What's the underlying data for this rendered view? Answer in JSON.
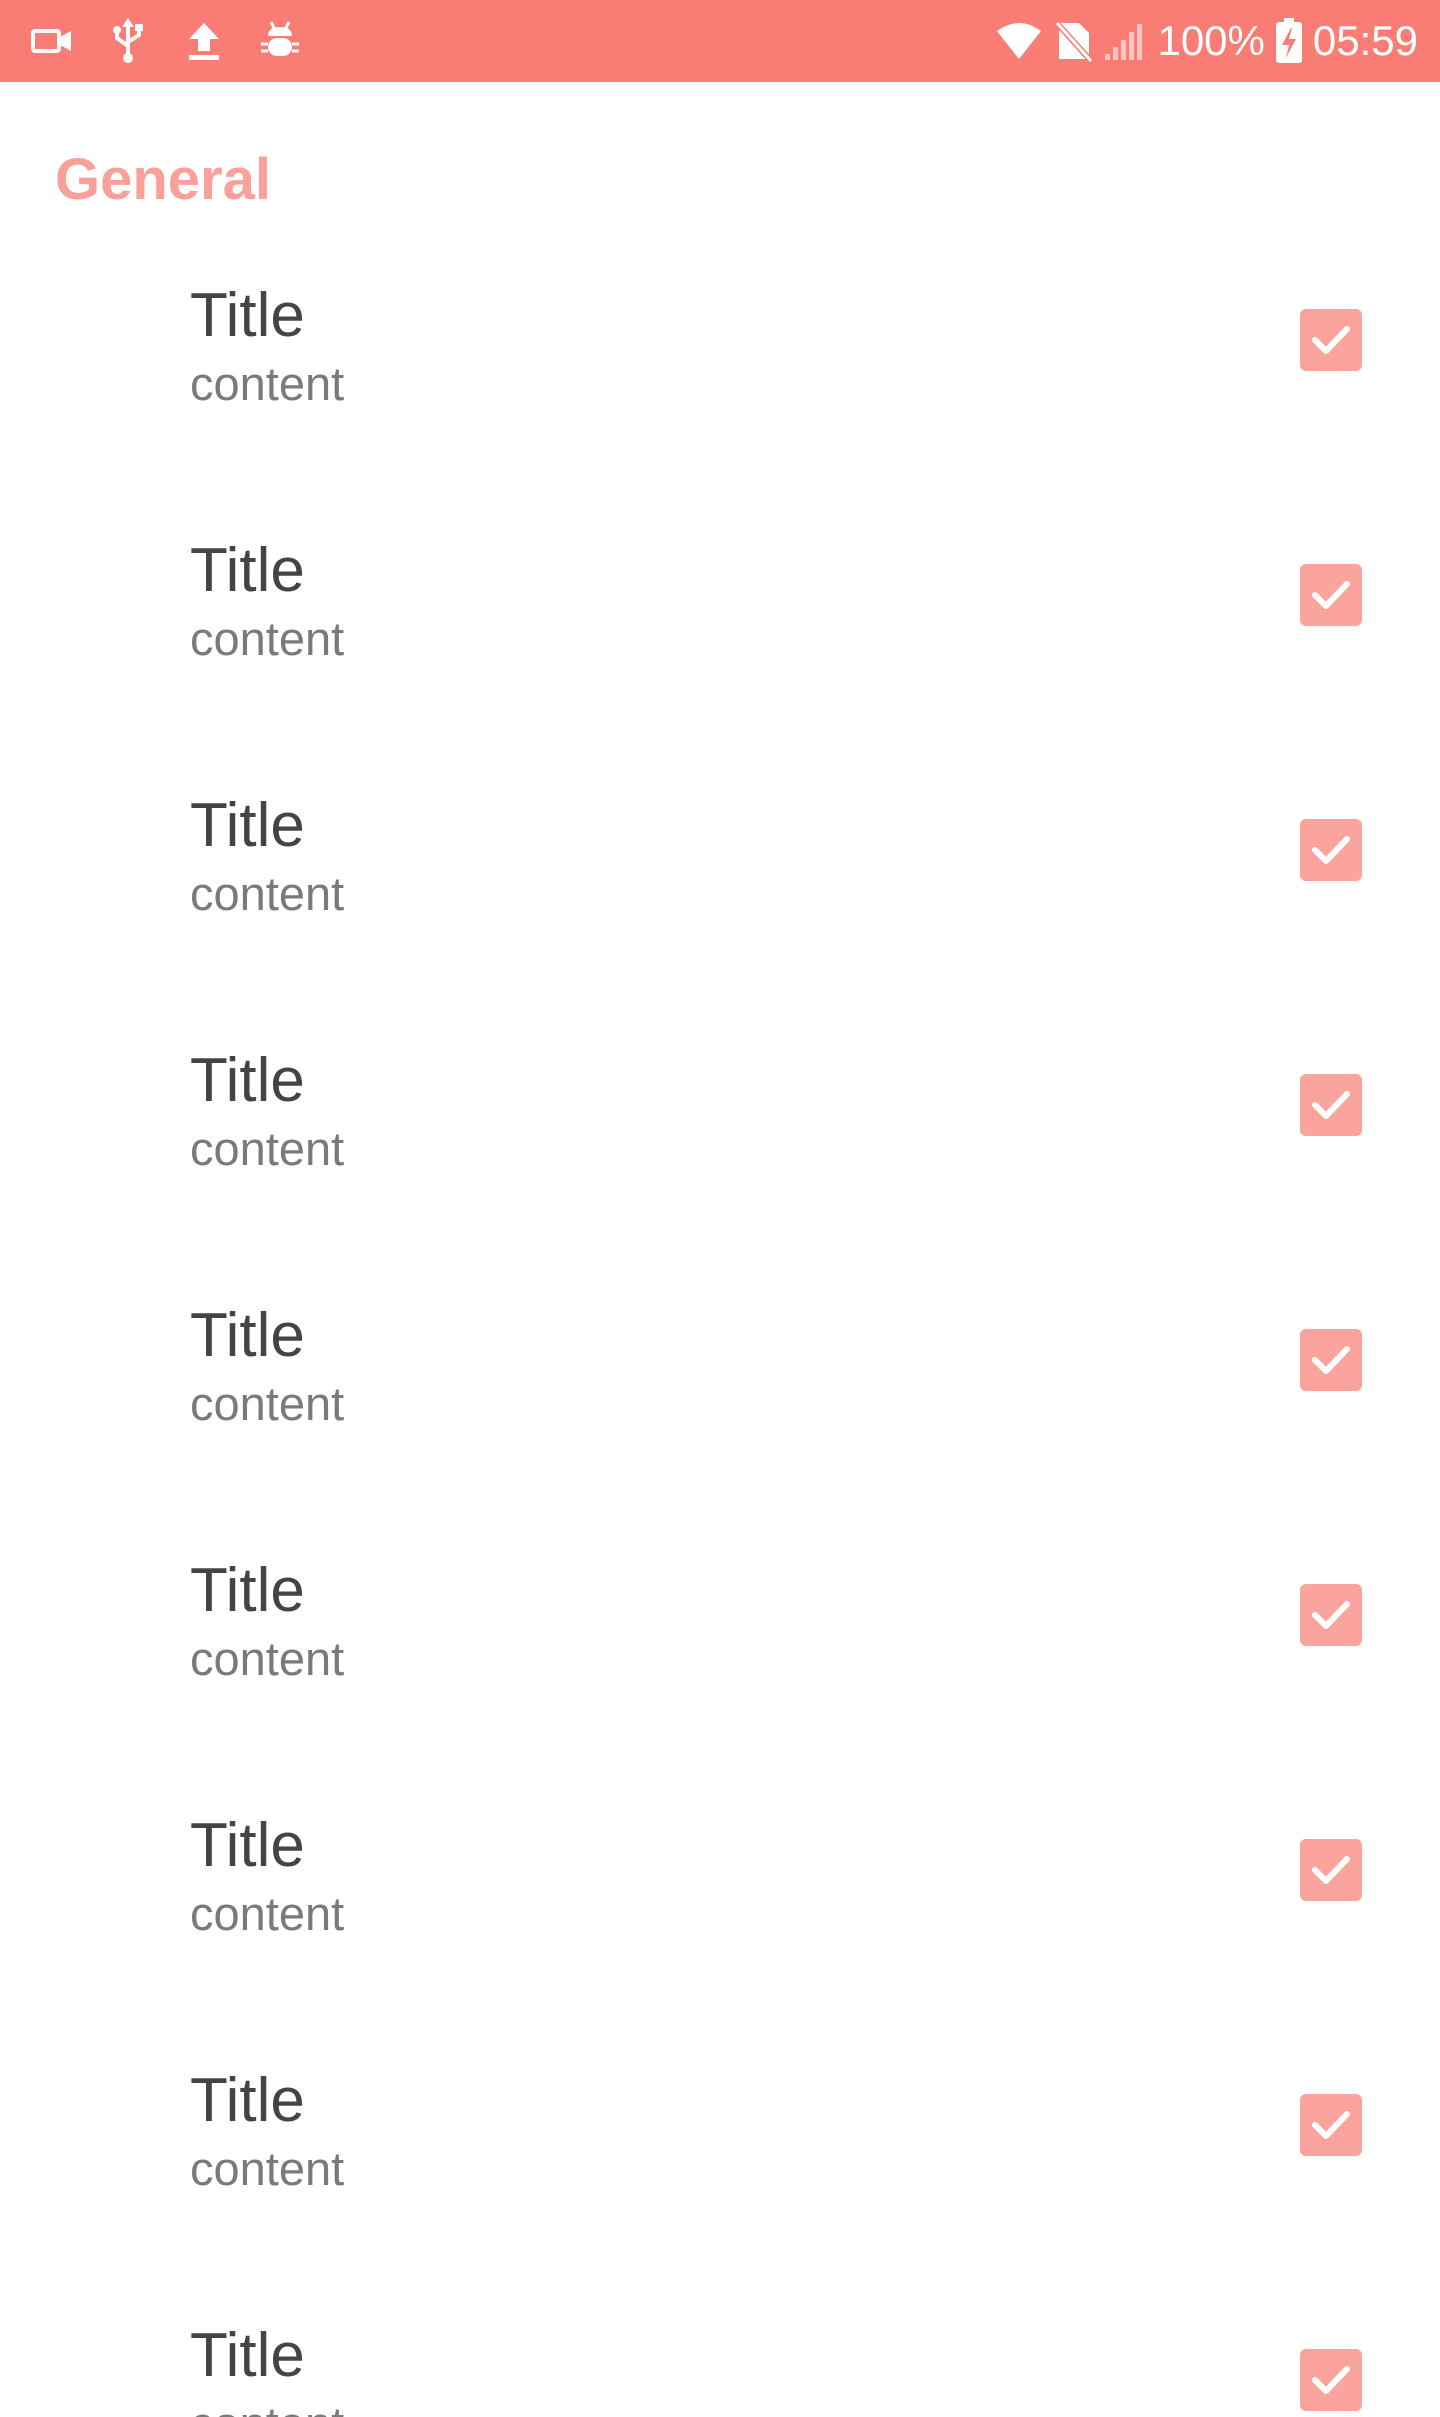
{
  "status_bar": {
    "background": "#fa7d75",
    "left_icons": [
      "video-camera-icon",
      "usb-icon",
      "upload-icon",
      "android-debug-icon"
    ],
    "right_icons": [
      "wifi-icon",
      "no-sim-icon",
      "signal-icon"
    ],
    "battery_percent": "100%",
    "battery_icon": "battery-charging-icon",
    "time": "05:59"
  },
  "colors": {
    "accent": "#f9a098",
    "checkbox": "#fba49d",
    "title_text": "#444444",
    "summary_text": "#7a7a7a"
  },
  "section": {
    "header": "General"
  },
  "preferences": [
    {
      "title": "Title",
      "summary": "content",
      "checked": true
    },
    {
      "title": "Title",
      "summary": "content",
      "checked": true
    },
    {
      "title": "Title",
      "summary": "content",
      "checked": true
    },
    {
      "title": "Title",
      "summary": "content",
      "checked": true
    },
    {
      "title": "Title",
      "summary": "content",
      "checked": true
    },
    {
      "title": "Title",
      "summary": "content",
      "checked": true
    },
    {
      "title": "Title",
      "summary": "content",
      "checked": true
    },
    {
      "title": "Title",
      "summary": "content",
      "checked": true
    },
    {
      "title": "Title",
      "summary": "content",
      "checked": true
    }
  ]
}
